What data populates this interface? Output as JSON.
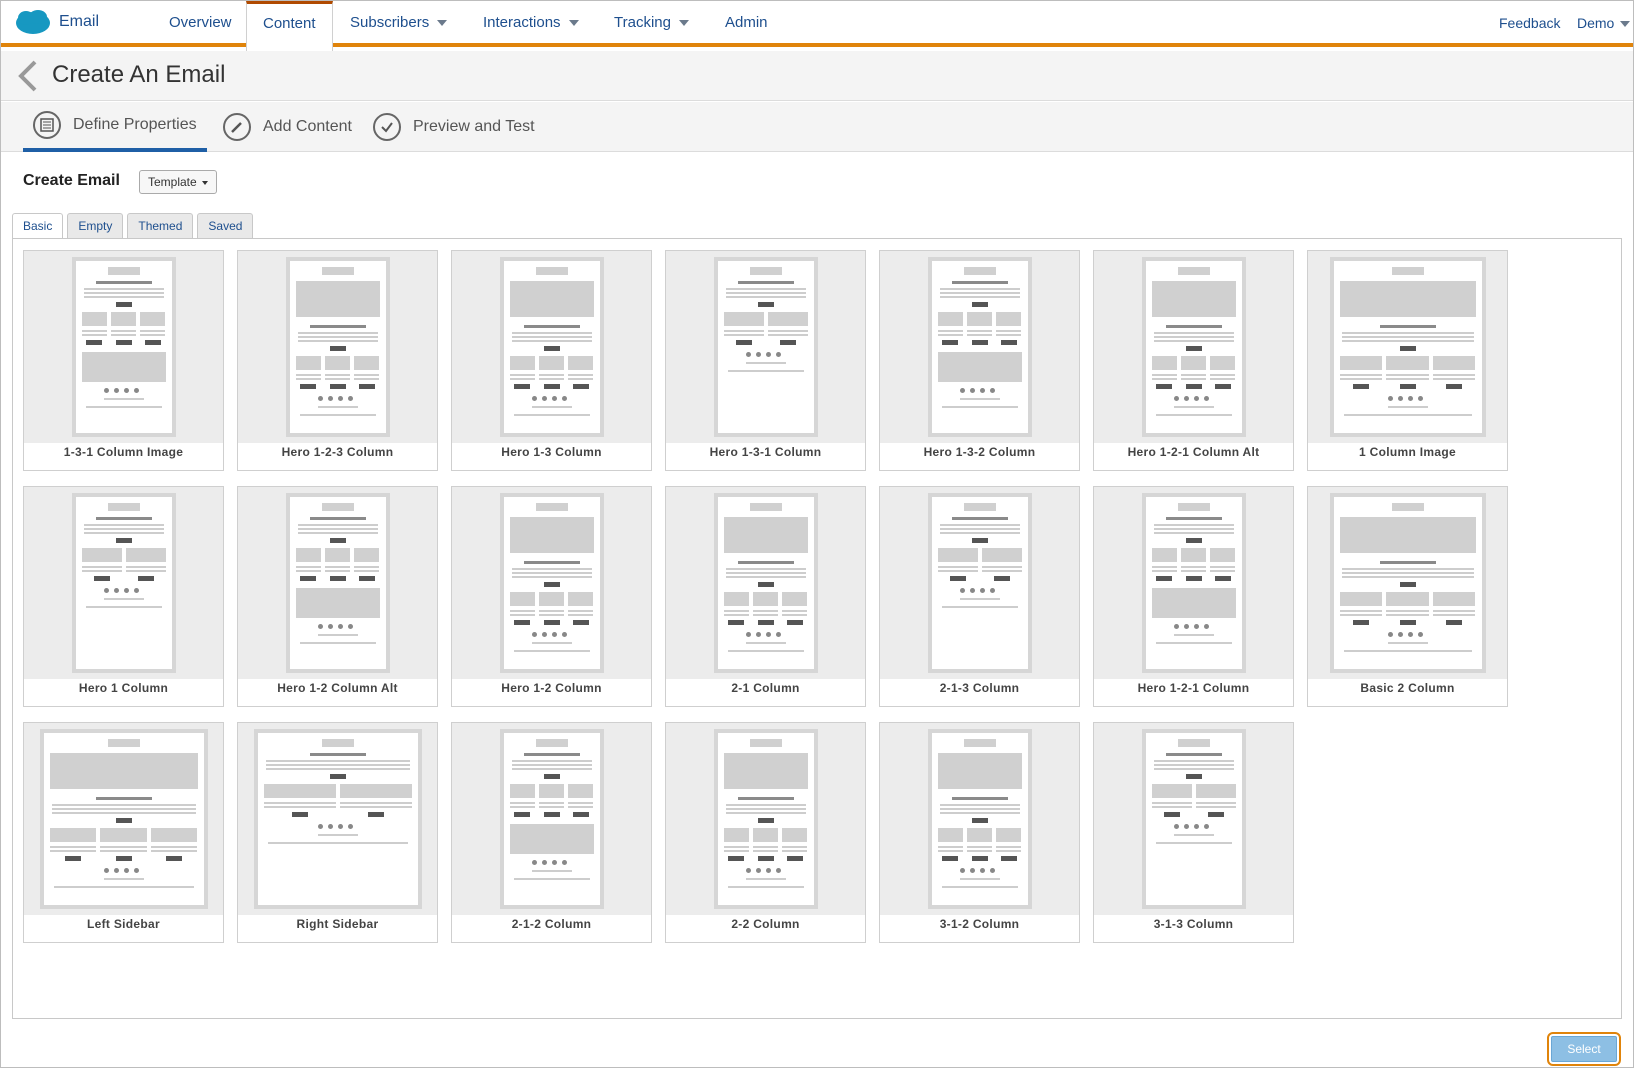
{
  "nav": {
    "app_name": "Email",
    "items": [
      "Overview",
      "Content",
      "Subscribers",
      "Interactions",
      "Tracking",
      "Admin"
    ],
    "feedback": "Feedback",
    "user": "Demo"
  },
  "page": {
    "title": "Create An Email"
  },
  "steps": [
    "Define Properties",
    "Add Content",
    "Preview and Test"
  ],
  "create": {
    "label": "Create Email",
    "dropdown_value": "Template"
  },
  "tabs": [
    "Basic",
    "Empty",
    "Themed",
    "Saved"
  ],
  "templates": [
    "1-3-1 Column Image",
    "Hero 1-2-3 Column",
    "Hero 1-3 Column",
    "Hero 1-3-1 Column",
    "Hero 1-3-2 Column",
    "Hero 1-2-1 Column Alt",
    "1 Column Image",
    "Hero 1 Column",
    "Hero 1-2 Column Alt",
    "Hero 1-2 Column",
    "2-1 Column",
    "2-1-3 Column",
    "Hero 1-2-1 Column",
    "Basic 2 Column",
    "Left Sidebar",
    "Right Sidebar",
    "2-1-2 Column",
    "2-2 Column",
    "3-1-2 Column",
    "3-1-3 Column"
  ],
  "footer": {
    "select_label": "Select"
  }
}
